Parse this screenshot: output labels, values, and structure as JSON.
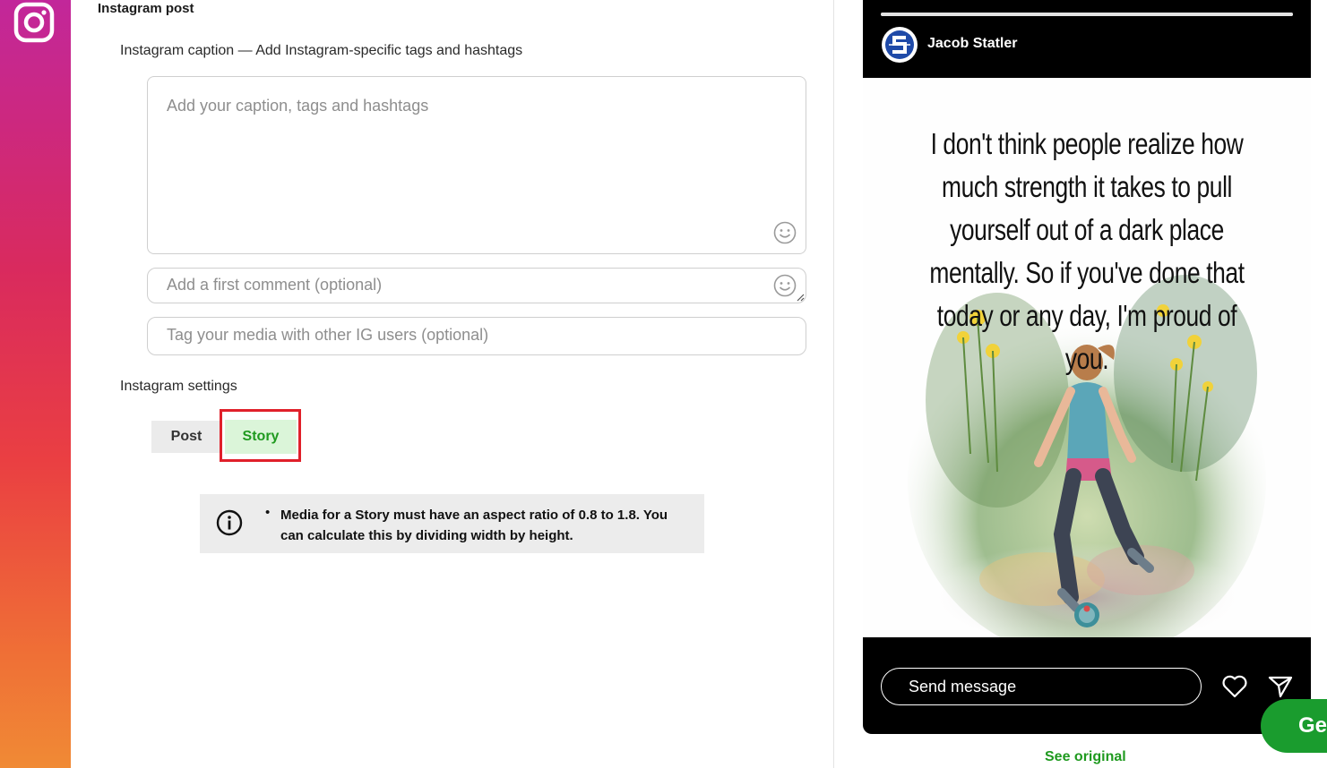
{
  "colors": {
    "accent_green": "#1f9a1f",
    "story_bg": "#dbf5d9",
    "highlight_red": "#e0202a",
    "info_bg": "#ececec"
  },
  "sidebar": {
    "icon": "instagram-icon"
  },
  "form": {
    "section_title": "Instagram post",
    "caption_label": "Instagram caption — Add Instagram-specific tags and hashtags",
    "caption_placeholder": "Add your caption, tags and hashtags",
    "first_comment_placeholder": "Add a first comment (optional)",
    "tag_users_placeholder": "Tag your media with other IG users (optional)",
    "settings_label": "Instagram settings",
    "post_type": {
      "options": [
        "Post",
        "Story"
      ],
      "selected": "Story"
    },
    "info": {
      "icon": "info-circle-icon",
      "bullet": "•",
      "message": "Media for a Story must have an aspect ratio of 0.8 to 1.8. You can calculate this by dividing width by height."
    }
  },
  "preview": {
    "username": "Jacob Statler",
    "story_progress": 1.0,
    "quote": "I don't think people realize how much strength it takes to pull yourself out of a dark place mentally. So if you've done that today or any day, I'm proud of you.",
    "reply_placeholder": "Send message",
    "icons": [
      "heart-icon",
      "send-icon"
    ],
    "see_original": "See original"
  },
  "floating_button": {
    "label": "Ge"
  }
}
